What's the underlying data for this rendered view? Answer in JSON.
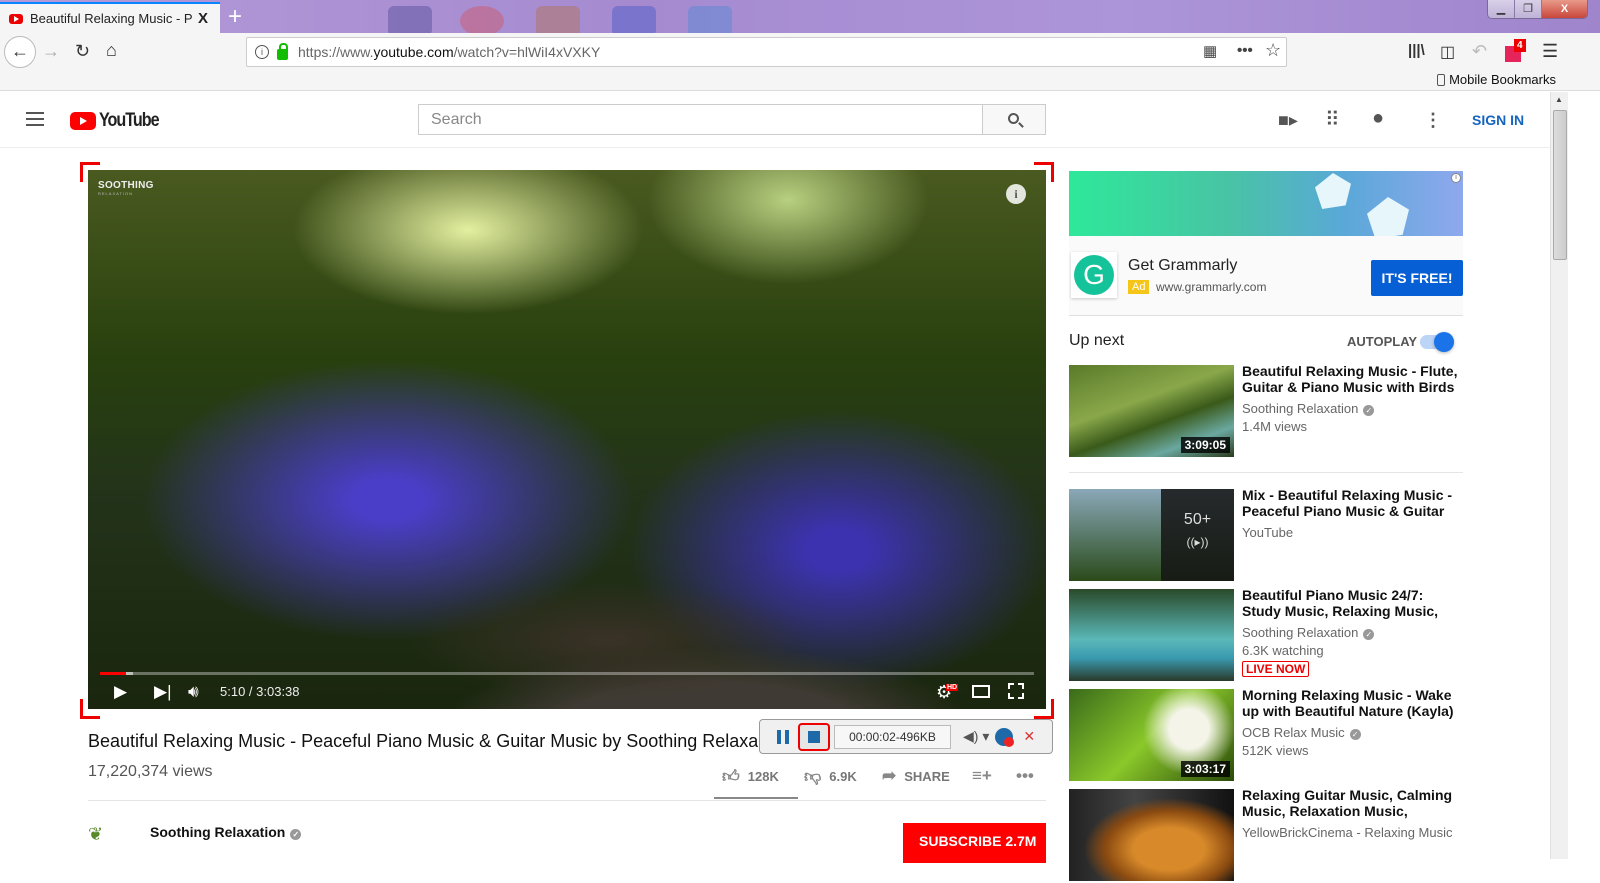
{
  "browser": {
    "tab_title": "Beautiful Relaxing Music - Peaceful",
    "tab_close": "X",
    "new_tab": "+",
    "url_prefix": "https://www.",
    "url_domain": "youtube.com",
    "url_path": "/watch?v=hlWiI4xVXKY",
    "bookmarks_label": "Mobile Bookmarks",
    "extension_badge": "4",
    "window_buttons": {
      "minimize": "▁",
      "restore": "❐",
      "close": "X"
    }
  },
  "youtube": {
    "logo_text": "YouTube",
    "search_placeholder": "Search",
    "sign_in": "SIGN IN",
    "icons": [
      "video-camera-add-icon",
      "apps-grid-icon",
      "messages-icon",
      "more-vert-icon"
    ]
  },
  "player": {
    "brand_line1": "SOOTHING",
    "brand_line2": "RELAXATION",
    "current_time": "5:10",
    "duration": "3:03:38",
    "time_display": "5:10 / 3:03:38",
    "played_fraction": 0.028,
    "buffered_fraction": 0.035,
    "quality_badge": "HD"
  },
  "recorder": {
    "status": "00:00:02-496KB",
    "accent": "#1e6aa8"
  },
  "video": {
    "title": "Beautiful Relaxing Music - Peaceful Piano Music & Guitar Music by Soothing Relaxation",
    "views": "17,220,374 views",
    "likes": "128K",
    "dislikes": "6.9K",
    "share": "SHARE",
    "channel": "Soothing Relaxation",
    "subscribe": "SUBSCRIBE 2.7M"
  },
  "ad": {
    "name": "Get Grammarly",
    "tag": "Ad",
    "domain": "www.grammarly.com",
    "cta": "IT'S FREE!"
  },
  "sidebar": {
    "up_next": "Up next",
    "autoplay": "AUTOPLAY",
    "autoplay_on": true,
    "items": [
      {
        "title": "Beautiful Relaxing Music - Flute, Guitar & Piano Music with Birds",
        "channel": "Soothing Relaxation",
        "verified": true,
        "meta": "1.4M views",
        "duration": "3:09:05"
      },
      {
        "title": "Mix - Beautiful Relaxing Music - Peaceful Piano Music & Guitar",
        "channel": "YouTube",
        "verified": false,
        "meta": "",
        "playlist_count": "50+"
      },
      {
        "title": "Beautiful Piano Music 24/7: Study Music, Relaxing Music,",
        "channel": "Soothing Relaxation",
        "verified": true,
        "meta": "6.3K watching",
        "badge": "LIVE NOW"
      },
      {
        "title": "Morning Relaxing Music - Wake up with Beautiful Nature (Kayla)",
        "channel": "OCB Relax Music",
        "verified": true,
        "meta": "512K views",
        "duration": "3:03:17"
      },
      {
        "title": "Relaxing Guitar Music, Calming Music, Relaxation Music,",
        "channel": "YellowBrickCinema - Relaxing Music",
        "verified": false,
        "meta": ""
      }
    ]
  }
}
